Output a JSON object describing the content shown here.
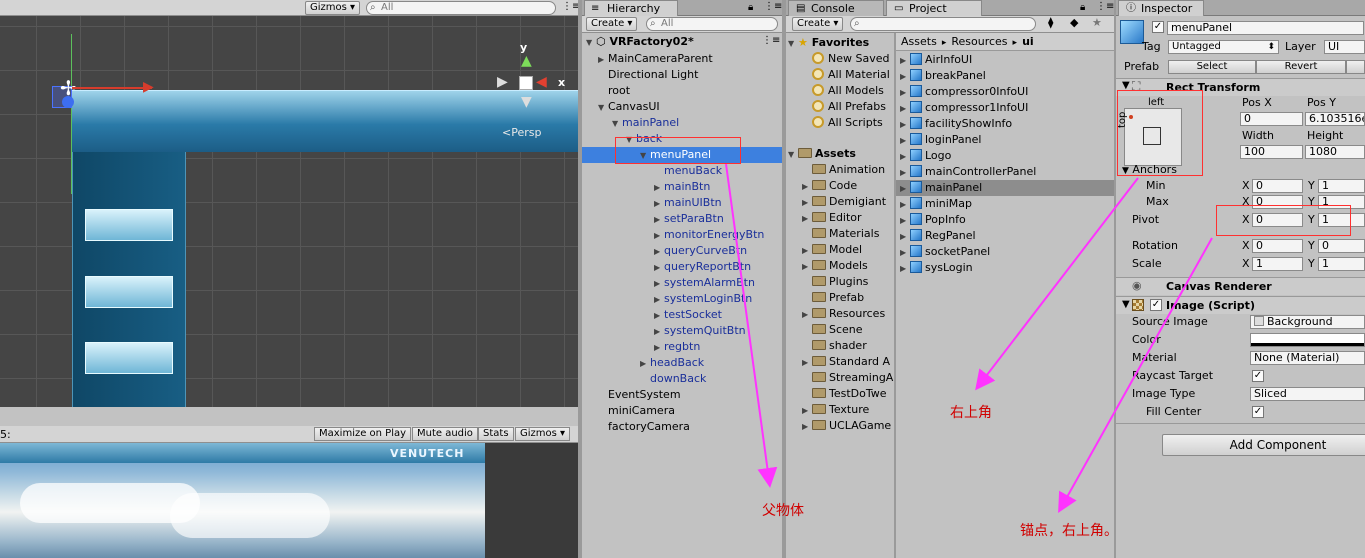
{
  "scene": {
    "gizmos_label": "Gizmos",
    "search_placeholder": "All",
    "persp_label": "Persp",
    "axis_y": "y",
    "axis_x": "x"
  },
  "game": {
    "left_label": "5:",
    "maximize_label": "Maximize on Play",
    "mute_label": "Mute audio",
    "stats_label": "Stats",
    "gizmos_label": "Gizmos",
    "logo_text": "VENUTECH"
  },
  "hierarchy": {
    "tab_label": "Hierarchy",
    "create_label": "Create",
    "search_placeholder": "All",
    "scene_name": "VRFactory02*",
    "items": [
      {
        "label": "MainCameraParent",
        "blue": false,
        "arrow": "right",
        "indent": 0
      },
      {
        "label": "Directional Light",
        "blue": false,
        "arrow": "",
        "indent": 0
      },
      {
        "label": "root",
        "blue": false,
        "arrow": "",
        "indent": 0
      },
      {
        "label": "CanvasUI",
        "blue": false,
        "arrow": "down",
        "indent": 0
      },
      {
        "label": "mainPanel",
        "blue": true,
        "arrow": "down",
        "indent": 1
      },
      {
        "label": "back",
        "blue": true,
        "arrow": "down",
        "indent": 2
      },
      {
        "label": "menuPanel",
        "blue": true,
        "arrow": "down",
        "indent": 3
      },
      {
        "label": "menuBack",
        "blue": true,
        "arrow": "",
        "indent": 4
      },
      {
        "label": "mainBtn",
        "blue": true,
        "arrow": "right",
        "indent": 4
      },
      {
        "label": "mainUIBtn",
        "blue": true,
        "arrow": "right",
        "indent": 4
      },
      {
        "label": "setParaBtn",
        "blue": true,
        "arrow": "right",
        "indent": 4
      },
      {
        "label": "monitorEnergyBtn",
        "blue": true,
        "arrow": "right",
        "indent": 4
      },
      {
        "label": "queryCurveBtn",
        "blue": true,
        "arrow": "right",
        "indent": 4
      },
      {
        "label": "queryReportBtn",
        "blue": true,
        "arrow": "right",
        "indent": 4
      },
      {
        "label": "systemAlarmBtn",
        "blue": true,
        "arrow": "right",
        "indent": 4
      },
      {
        "label": "systemLoginBtn",
        "blue": true,
        "arrow": "right",
        "indent": 4
      },
      {
        "label": "testSocket",
        "blue": true,
        "arrow": "right",
        "indent": 4
      },
      {
        "label": "systemQuitBtn",
        "blue": true,
        "arrow": "right",
        "indent": 4
      },
      {
        "label": "regbtn",
        "blue": true,
        "arrow": "right",
        "indent": 4
      },
      {
        "label": "headBack",
        "blue": true,
        "arrow": "right",
        "indent": 3
      },
      {
        "label": "downBack",
        "blue": true,
        "arrow": "",
        "indent": 3
      },
      {
        "label": "EventSystem",
        "blue": false,
        "arrow": "",
        "indent": 0
      },
      {
        "label": "miniCamera",
        "blue": false,
        "arrow": "",
        "indent": 0
      },
      {
        "label": "factoryCamera",
        "blue": false,
        "arrow": "",
        "indent": 0
      }
    ],
    "selected_index": 6
  },
  "project": {
    "console_tab": "Console",
    "project_tab": "Project",
    "create_label": "Create",
    "favorites_label": "Favorites",
    "favorites": [
      "New Saved",
      "All Material",
      "All Models",
      "All Prefabs",
      "All Scripts"
    ],
    "assets_label": "Assets",
    "folders": [
      {
        "label": "Animation",
        "arrow": false
      },
      {
        "label": "Code",
        "arrow": true
      },
      {
        "label": "Demigiant",
        "arrow": true
      },
      {
        "label": "Editor",
        "arrow": true
      },
      {
        "label": "Materials",
        "arrow": false
      },
      {
        "label": "Model",
        "arrow": true
      },
      {
        "label": "Models",
        "arrow": true
      },
      {
        "label": "Plugins",
        "arrow": false
      },
      {
        "label": "Prefab",
        "arrow": false
      },
      {
        "label": "Resources",
        "arrow": true
      },
      {
        "label": "Scene",
        "arrow": false
      },
      {
        "label": "shader",
        "arrow": false
      },
      {
        "label": "Standard A",
        "arrow": true
      },
      {
        "label": "StreamingA",
        "arrow": false
      },
      {
        "label": "TestDoTwe",
        "arrow": false
      },
      {
        "label": "Texture",
        "arrow": true
      },
      {
        "label": "UCLAGame",
        "arrow": true
      }
    ],
    "breadcrumb": [
      "Assets",
      "Resources",
      "ui"
    ],
    "breadcrumb_sep": "▸",
    "assets": [
      "AirInfoUI",
      "breakPanel",
      "compressor0InfoUI",
      "compressor1InfoUI",
      "facilityShowInfo",
      "loginPanel",
      "Logo",
      "mainControllerPanel",
      "mainPanel",
      "miniMap",
      "PopInfo",
      "RegPanel",
      "socketPanel",
      "sysLogin"
    ],
    "selected_asset_index": 8
  },
  "inspector": {
    "tab_label": "Inspector",
    "object_name": "menuPanel",
    "tag_label": "Tag",
    "tag_value": "Untagged",
    "layer_label": "Layer",
    "layer_value": "UI",
    "prefab_label": "Prefab",
    "select_label": "Select",
    "revert_label": "Revert",
    "rect_transform_label": "Rect Transform",
    "anchor_h_label": "left",
    "anchor_v_label": "top",
    "posx_label": "Pos X",
    "posy_label": "Pos Y",
    "posx_value": "0",
    "posy_value": "6.103516e",
    "width_label": "Width",
    "height_label": "Height",
    "width_value": "100",
    "height_value": "1080",
    "anchors_label": "Anchors",
    "min_label": "Min",
    "max_label": "Max",
    "x_label": "X",
    "y_label": "Y",
    "min_x": "0",
    "min_y": "1",
    "max_x": "0",
    "max_y": "1",
    "pivot_label": "Pivot",
    "pivot_x": "0",
    "pivot_y": "1",
    "rotation_label": "Rotation",
    "rot_x": "0",
    "rot_y": "0",
    "scale_label": "Scale",
    "scale_x": "1",
    "scale_y": "1",
    "canvas_renderer_label": "Canvas Renderer",
    "image_label": "Image (Script)",
    "source_image_label": "Source Image",
    "source_image_value": "Background",
    "color_label": "Color",
    "material_label": "Material",
    "material_value": "None (Material)",
    "raycast_label": "Raycast Target",
    "image_type_label": "Image Type",
    "image_type_value": "Sliced",
    "fill_center_label": "Fill Center",
    "add_component_label": "Add Component"
  },
  "annotations": {
    "parent": "父物体",
    "top_right": "右上角",
    "anchor": "锚点，右上角。"
  },
  "colors": {
    "selection": "#3d80df",
    "annotation_arrow": "#ff33ff",
    "annotation_box": "#ff3030",
    "annotation_text": "#d00000",
    "hierarchy_blue": "#1a2f9a"
  }
}
